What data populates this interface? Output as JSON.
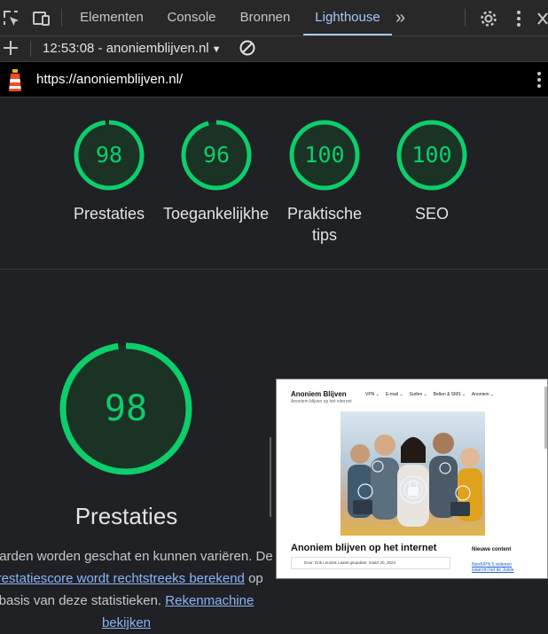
{
  "tabs": [
    {
      "label": "Elementen"
    },
    {
      "label": "Console"
    },
    {
      "label": "Bronnen"
    },
    {
      "label": "Lighthouse"
    }
  ],
  "toolbar": {
    "report_time": "12:53:08 - anoniemblijven.nl"
  },
  "urlbar": {
    "url": "https://anoniemblijven.nl/"
  },
  "scores": [
    {
      "value": "98",
      "label": "Prestaties",
      "label2": ""
    },
    {
      "value": "96",
      "label": "Toegankelijkheid",
      "label2": ""
    },
    {
      "value": "100",
      "label": "Praktische",
      "label2": "tips"
    },
    {
      "value": "100",
      "label": "SEO",
      "label2": ""
    }
  ],
  "performance": {
    "score": "98",
    "title": "Prestaties",
    "desc_1": "Waarden worden geschat en kunnen variëren. De",
    "desc_link_1": "prestatiescore wordt rechtstreeks berekend",
    "desc_2": "op",
    "desc_3": "basis van deze statistieken.",
    "desc_link_2": "Rekenmachine",
    "desc_link_3": "bekijken"
  },
  "screenshot": {
    "site_name": "Anoniem Blijven",
    "tagline": "Anoniem blijven op het internet",
    "nav": [
      "VPN",
      "E-mail",
      "Surfen",
      "Bellen & SMS",
      "Anoniem"
    ],
    "heading": "Anoniem blijven op het internet",
    "byline": "Door: Erik Leusink   Laatst geupdate: maart 20, 2024",
    "sidebar_title": "Nieuwe content",
    "sidebar_link": "NordVPN 5 redenen waarom het de Juiste"
  },
  "colors": {
    "score_good": "#0cce6b",
    "link": "#8ab4f8",
    "active_tab": "#a8c7fa"
  }
}
